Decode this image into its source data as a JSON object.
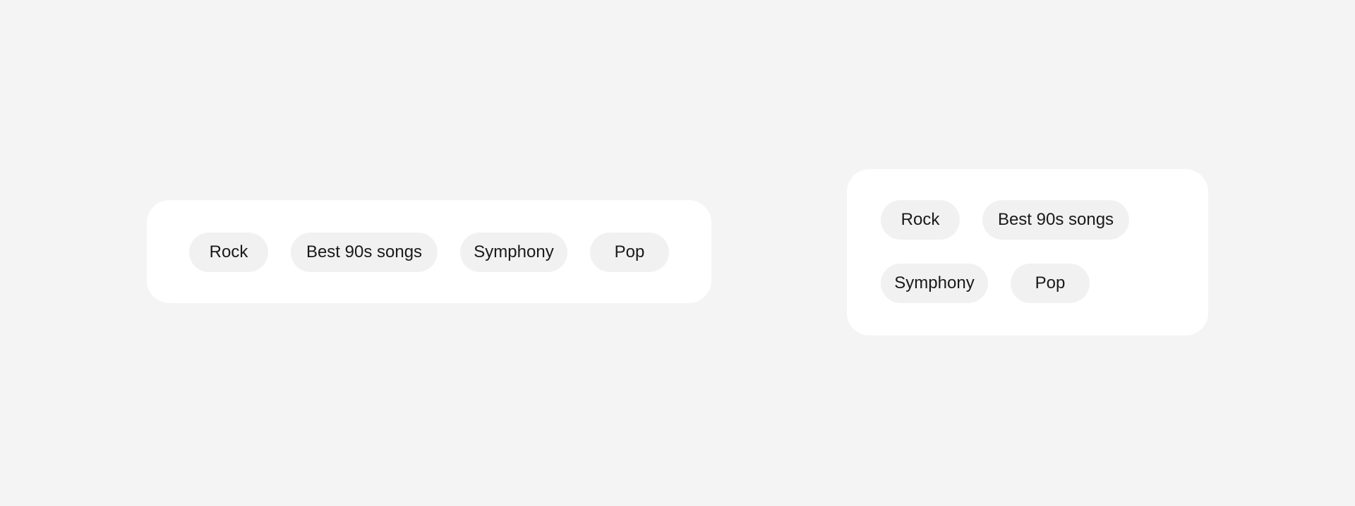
{
  "chips_wide": [
    {
      "label": "Rock"
    },
    {
      "label": "Best 90s songs"
    },
    {
      "label": "Symphony"
    },
    {
      "label": "Pop"
    }
  ],
  "chips_narrow": [
    {
      "label": "Rock"
    },
    {
      "label": "Best 90s songs"
    },
    {
      "label": "Symphony"
    },
    {
      "label": "Pop"
    }
  ],
  "colors": {
    "background": "#f4f4f4",
    "card": "#ffffff",
    "chip": "#f1f1f1",
    "text": "#191919"
  }
}
